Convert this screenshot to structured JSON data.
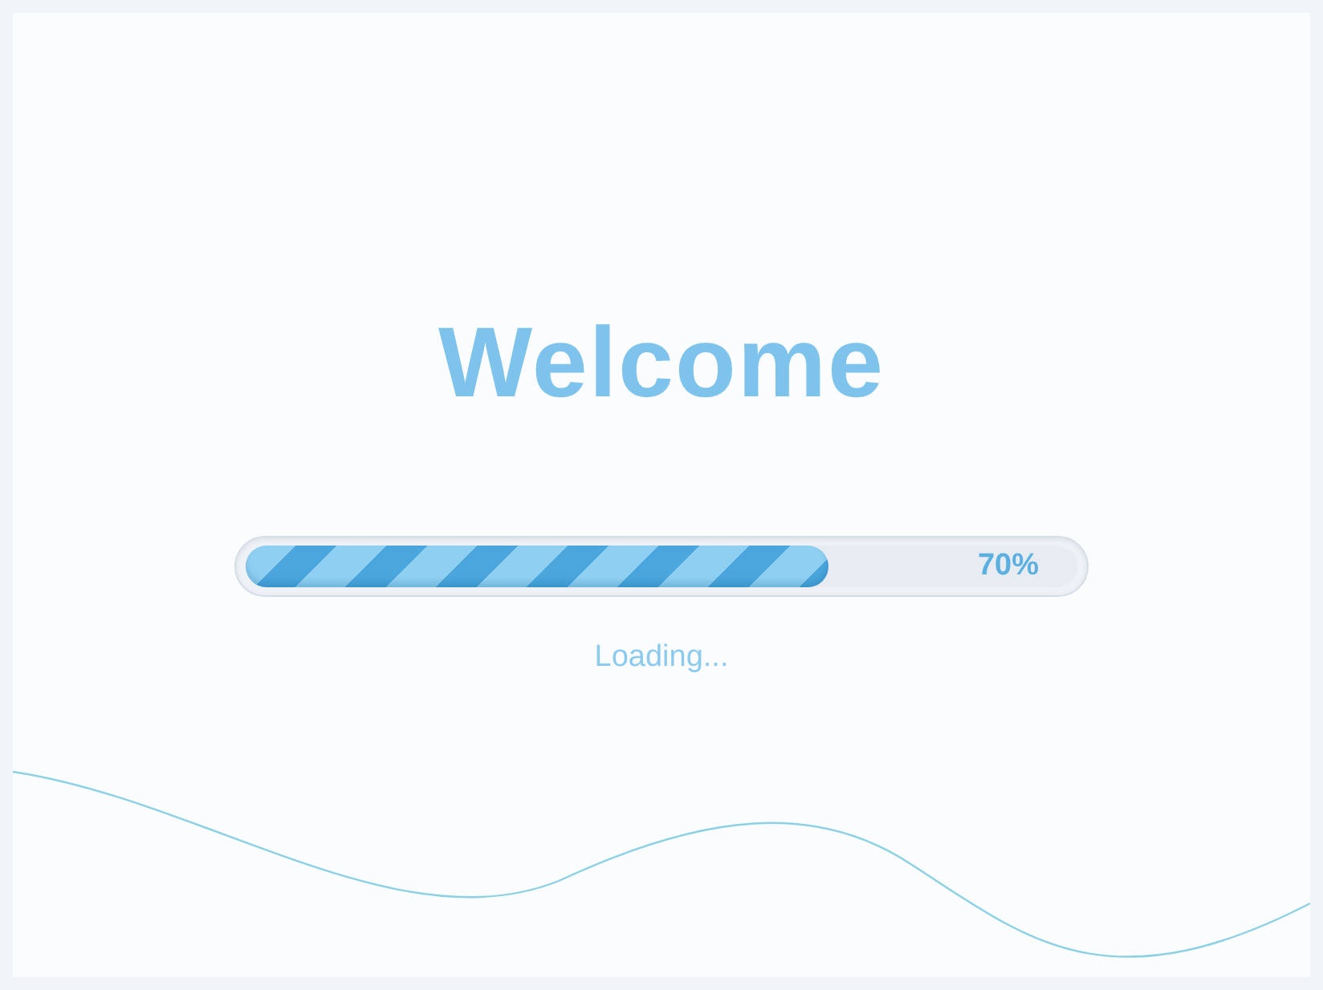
{
  "title": "Welcome",
  "progress": {
    "level": 0.7,
    "reading": "70%"
  },
  "status": "Loading..."
}
